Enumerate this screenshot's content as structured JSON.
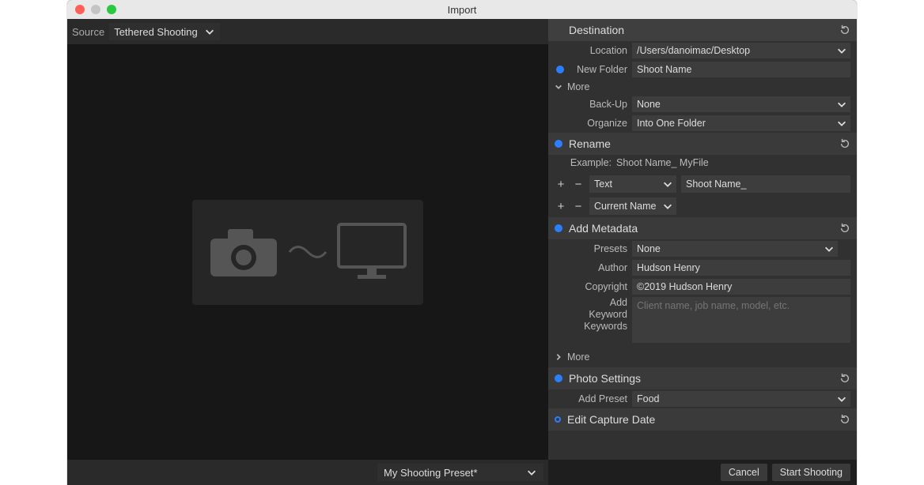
{
  "window": {
    "title": "Import"
  },
  "source": {
    "label": "Source",
    "value": "Tethered Shooting"
  },
  "preset_bar": {
    "value": "My Shooting Preset*"
  },
  "destination": {
    "title": "Destination",
    "location_label": "Location",
    "location_value": "/Users/danoimac/Desktop",
    "new_folder_label": "New Folder",
    "new_folder_value": "Shoot Name",
    "more_label": "More",
    "backup_label": "Back-Up",
    "backup_value": "None",
    "organize_label": "Organize",
    "organize_value": "Into One Folder"
  },
  "rename": {
    "title": "Rename",
    "example_label": "Example:",
    "example_value": "Shoot Name_ MyFile",
    "token1_type": "Text",
    "token1_value": "Shoot Name_",
    "token2_type": "Current Name"
  },
  "metadata": {
    "title": "Add Metadata",
    "presets_label": "Presets",
    "presets_value": "None",
    "author_label": "Author",
    "author_value": "Hudson Henry",
    "copyright_label": "Copyright",
    "copyright_value": "©2019 Hudson Henry",
    "add_keyword_label": "Add Keyword",
    "keywords_label": "Keywords",
    "keywords_placeholder": "Client name, job name, model, etc.",
    "more_label": "More"
  },
  "photo_settings": {
    "title": "Photo Settings",
    "add_preset_label": "Add Preset",
    "add_preset_value": "Food"
  },
  "capture_date": {
    "title": "Edit Capture Date"
  },
  "footer": {
    "cancel": "Cancel",
    "start": "Start Shooting"
  }
}
